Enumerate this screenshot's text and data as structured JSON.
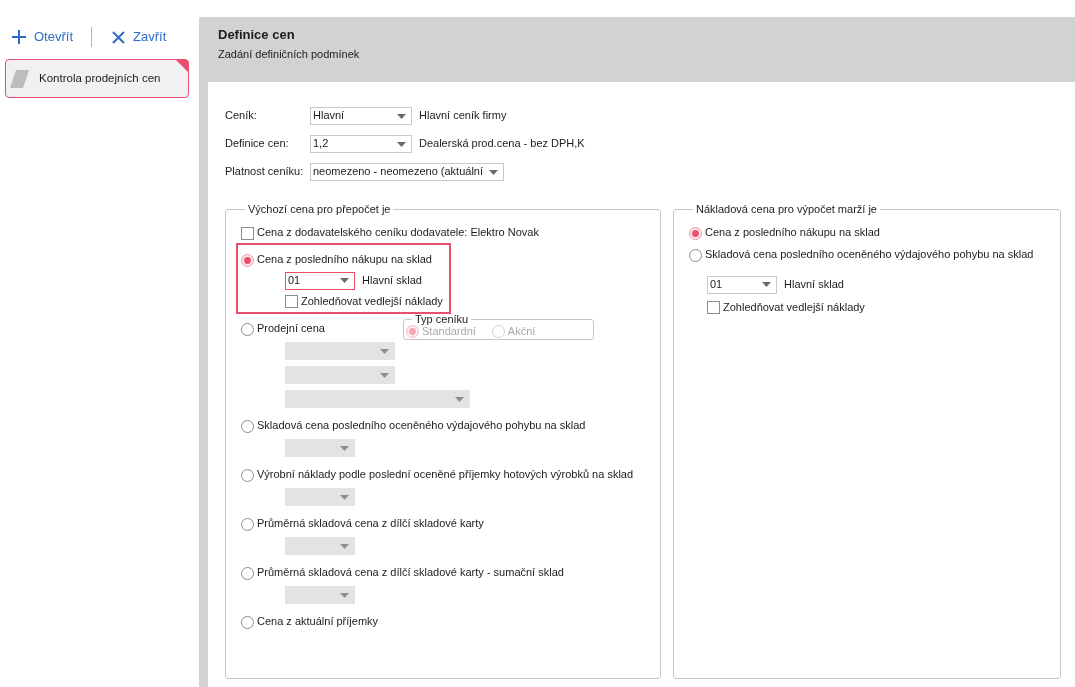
{
  "toolbar": [
    {
      "kind": "open",
      "label": "Otevřít"
    },
    {
      "kind": "close",
      "label": "Zavřít"
    }
  ],
  "sidebar": {
    "items": [
      {
        "label": "Kontrola prodejních cen",
        "selected": true
      }
    ]
  },
  "header": {
    "title": "Definice cen",
    "subtitle": "Zadání definičních podmínek"
  },
  "fields": [
    {
      "kind": "standard",
      "label": "Ceník:",
      "value": "Hlavní",
      "description": "Hlavní ceník firmy"
    },
    {
      "kind": "standard",
      "label": "Definice cen:",
      "value": "1,2",
      "description": "Dealerská prod.cena - bez DPH,K"
    },
    {
      "kind": "wide",
      "label": "Platnost ceníku:",
      "value": "neomezeno - neomezeno (aktuální"
    }
  ],
  "groups": [
    {
      "title": "Výchozí cena pro přepočet je",
      "options": [
        {
          "kind": "checkbox",
          "label": "Cena z dodavatelského ceníku dodavatele: Elektro Novak",
          "checked": false
        },
        {
          "kind": "radio",
          "label": "Cena z posledního nákupu na sklad",
          "selected": true,
          "highlighted": true,
          "controls": [
            {
              "kind": "narrowcombo",
              "value": "01",
              "description": "Hlavní sklad",
              "disabled": false,
              "focused": true
            },
            {
              "kind": "checkbox",
              "label": "Zohledňovat vedlejší náklady",
              "checked": false
            }
          ]
        },
        {
          "kind": "radio",
          "label": "Prodejní cena",
          "selected": false,
          "price_type": {
            "title": "Typ ceníku",
            "options": [
              {
                "label": "Standardní",
                "selected": true,
                "disabled": true
              },
              {
                "label": "Akční",
                "selected": false,
                "disabled": true
              }
            ]
          },
          "controls": [
            {
              "kind": "mediumcombo",
              "disabled": true
            },
            {
              "kind": "mediumcombo",
              "disabled": true
            },
            {
              "kind": "widecombo",
              "disabled": true
            }
          ]
        },
        {
          "kind": "radio",
          "label": "Skladová cena posledního oceněného výdajového pohybu na sklad",
          "selected": false,
          "controls": [
            {
              "kind": "narrowcombo",
              "disabled": true
            }
          ]
        },
        {
          "kind": "radio",
          "label": "Výrobní náklady podle poslední oceněné příjemky hotových výrobků na sklad",
          "selected": false,
          "controls": [
            {
              "kind": "narrowcombo",
              "disabled": true
            }
          ]
        },
        {
          "kind": "radio",
          "label": "Průměrná skladová cena z dílčí skladové karty",
          "selected": false,
          "controls": [
            {
              "kind": "narrowcombo",
              "disabled": true
            }
          ]
        },
        {
          "kind": "radio",
          "label": "Průměrná skladová cena z dílčí skladové karty - sumační sklad",
          "selected": false,
          "controls": [
            {
              "kind": "narrowcombo",
              "disabled": true
            }
          ]
        },
        {
          "kind": "radio",
          "label": "Cena z aktuální příjemky",
          "selected": false
        }
      ]
    },
    {
      "title": "Nákladová cena pro výpočet marží je",
      "options": [
        {
          "kind": "radio",
          "label": "Cena z posledního nákupu na sklad",
          "selected": true
        },
        {
          "kind": "radio",
          "label": "Skladová cena posledního oceněného výdajového pohybu na sklad",
          "selected": false
        }
      ],
      "controls": [
        {
          "kind": "narrowcombo",
          "value": "01",
          "description": "Hlavní sklad",
          "disabled": false
        },
        {
          "kind": "checkbox",
          "label": "Zohledňovat vedlejší náklady",
          "checked": false
        }
      ]
    }
  ]
}
